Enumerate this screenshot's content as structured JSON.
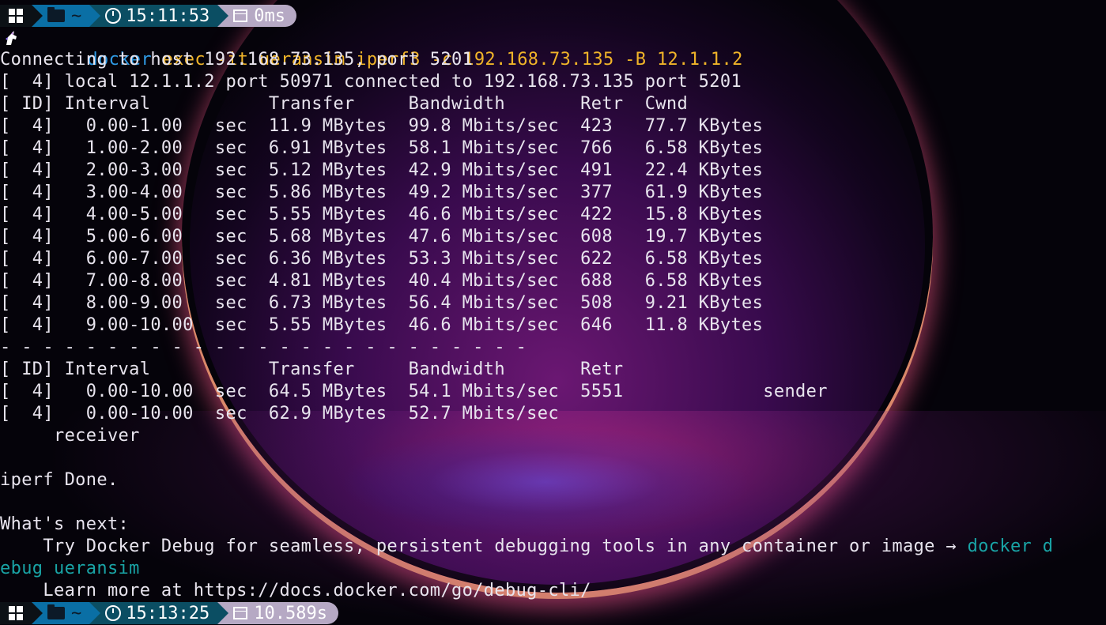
{
  "prompt_bar_top": {
    "dir": "~",
    "time": "15:11:53",
    "duration": "0ms"
  },
  "command": {
    "prefix_icon": "unicorn-icon",
    "cmd": "docker",
    "args": " exec -it ueransim iperf3 -c 192.168.73.135 -B 12.1.1.2"
  },
  "output_lines": [
    "Connecting to host 192.168.73.135, port 5201",
    "[  4] local 12.1.1.2 port 50971 connected to 192.168.73.135 port 5201",
    "[ ID] Interval           Transfer     Bandwidth       Retr  Cwnd",
    "[  4]   0.00-1.00   sec  11.9 MBytes  99.8 Mbits/sec  423   77.7 KBytes",
    "[  4]   1.00-2.00   sec  6.91 MBytes  58.1 Mbits/sec  766   6.58 KBytes",
    "[  4]   2.00-3.00   sec  5.12 MBytes  42.9 Mbits/sec  491   22.4 KBytes",
    "[  4]   3.00-4.00   sec  5.86 MBytes  49.2 Mbits/sec  377   61.9 KBytes",
    "[  4]   4.00-5.00   sec  5.55 MBytes  46.6 Mbits/sec  422   15.8 KBytes",
    "[  4]   5.00-6.00   sec  5.68 MBytes  47.6 Mbits/sec  608   19.7 KBytes",
    "[  4]   6.00-7.00   sec  6.36 MBytes  53.3 Mbits/sec  622   6.58 KBytes",
    "[  4]   7.00-8.00   sec  4.81 MBytes  40.4 Mbits/sec  688   6.58 KBytes",
    "[  4]   8.00-9.00   sec  6.73 MBytes  56.4 Mbits/sec  508   9.21 KBytes",
    "[  4]   9.00-10.00  sec  5.55 MBytes  46.6 Mbits/sec  646   11.8 KBytes",
    "- - - - - - - - - - - - - - - - - - - - - - - - -",
    "[ ID] Interval           Transfer     Bandwidth       Retr",
    "[  4]   0.00-10.00  sec  64.5 MBytes  54.1 Mbits/sec  5551             sender",
    "[  4]   0.00-10.00  sec  62.9 MBytes  52.7 Mbits/sec",
    "     receiver",
    "",
    "iperf Done.",
    "",
    "What's next:"
  ],
  "whats_next": {
    "line1_text": "    Try Docker Debug for seamless, persistent debugging tools in any container or image → ",
    "line1_cmd": "docker d",
    "line2_cmd": "ebug ueransim",
    "line3": "    Learn more at https://docs.docker.com/go/debug-cli/"
  },
  "prompt_bar_bottom": {
    "dir": "~",
    "time": "15:13:25",
    "duration": "10.589s"
  },
  "colors": {
    "win_segment": "#0c1116",
    "dir_segment": "#0a6fa5",
    "time_segment": "#0b4e63",
    "duration_segment": "#b6a9c4",
    "command_name": "#2f9be6",
    "command_args": "#f0b429",
    "suggestion_cmd": "#19a4a6"
  }
}
